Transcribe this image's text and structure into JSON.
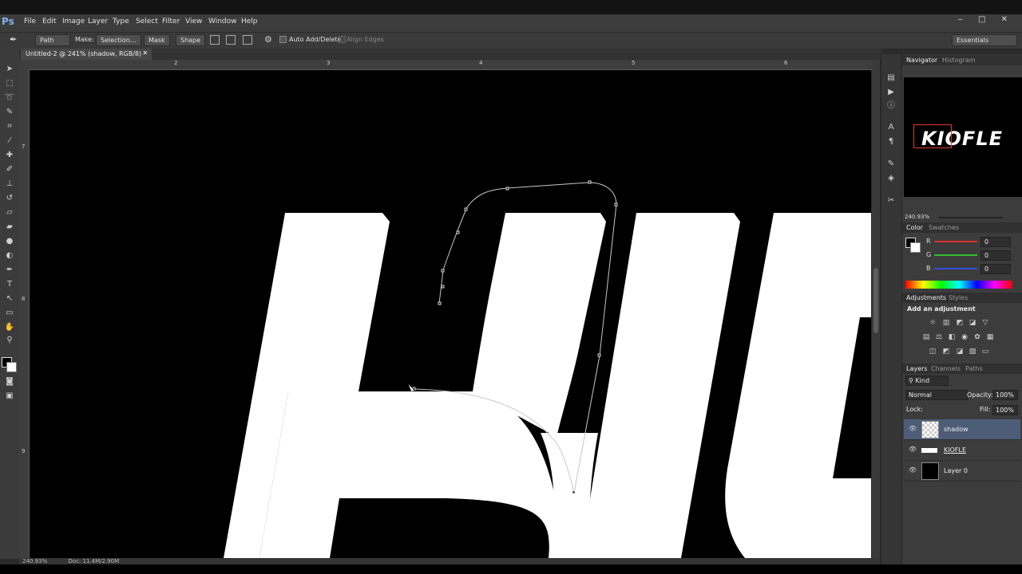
{
  "app": {
    "logo": "Ps"
  },
  "menu": [
    "File",
    "Edit",
    "Image",
    "Layer",
    "Type",
    "Select",
    "Filter",
    "View",
    "Window",
    "Help"
  ],
  "window_controls": "‒ □ ✕",
  "options": {
    "mode": "Path",
    "make_label": "Make:",
    "selection": "Selection...",
    "mask": "Mask",
    "shape": "Shape",
    "auto_add_delete": "Auto Add/Delete",
    "align_edges": "Align Edges",
    "workspace": "Essentials"
  },
  "document": {
    "tab_title": "Untitled-2 @ 241% (shadow, RGB/8) *",
    "close": "×"
  },
  "rulers": {
    "top": [
      "2",
      "3",
      "4",
      "5",
      "6"
    ],
    "left": [
      "7",
      "8",
      "9"
    ]
  },
  "status": {
    "zoom": "240.93%",
    "doc": "Doc: 11.4M/2.90M"
  },
  "navigator": {
    "tabs": [
      "Navigator",
      "Histogram"
    ],
    "preview_text": "KIOFLE",
    "zoom": "240.93%"
  },
  "color_panel": {
    "tabs": [
      "Color",
      "Swatches"
    ],
    "channels": [
      {
        "label": "R",
        "value": "0",
        "color": "#e03030"
      },
      {
        "label": "G",
        "value": "0",
        "color": "#30c030"
      },
      {
        "label": "B",
        "value": "0",
        "color": "#3050e0"
      }
    ]
  },
  "adjustments": {
    "tabs": [
      "Adjustments",
      "Styles"
    ],
    "heading": "Add an adjustment"
  },
  "layers_panel": {
    "tabs": [
      "Layers",
      "Channels",
      "Paths"
    ],
    "kind": "Kind",
    "blend": "Normal",
    "opacity_label": "Opacity:",
    "opacity": "100%",
    "lock_label": "Lock:",
    "fill_label": "Fill:",
    "fill": "100%",
    "layers": [
      {
        "name": "shadow",
        "selected": true,
        "thumb": "transparent"
      },
      {
        "name": "KIOFLE",
        "selected": false,
        "thumb": "text"
      },
      {
        "name": "Layer 0",
        "selected": false,
        "thumb": "black"
      }
    ]
  },
  "icons": {
    "tools": [
      "move-icon",
      "marquee-icon",
      "lasso-icon",
      "quick-select-icon",
      "crop-icon",
      "eyedropper-icon",
      "healing-icon",
      "brush-icon",
      "stamp-icon",
      "history-brush-icon",
      "eraser-icon",
      "gradient-icon",
      "blur-icon",
      "dodge-icon",
      "pen-icon",
      "type-icon",
      "path-select-icon",
      "rectangle-icon",
      "hand-icon",
      "zoom-icon"
    ]
  }
}
